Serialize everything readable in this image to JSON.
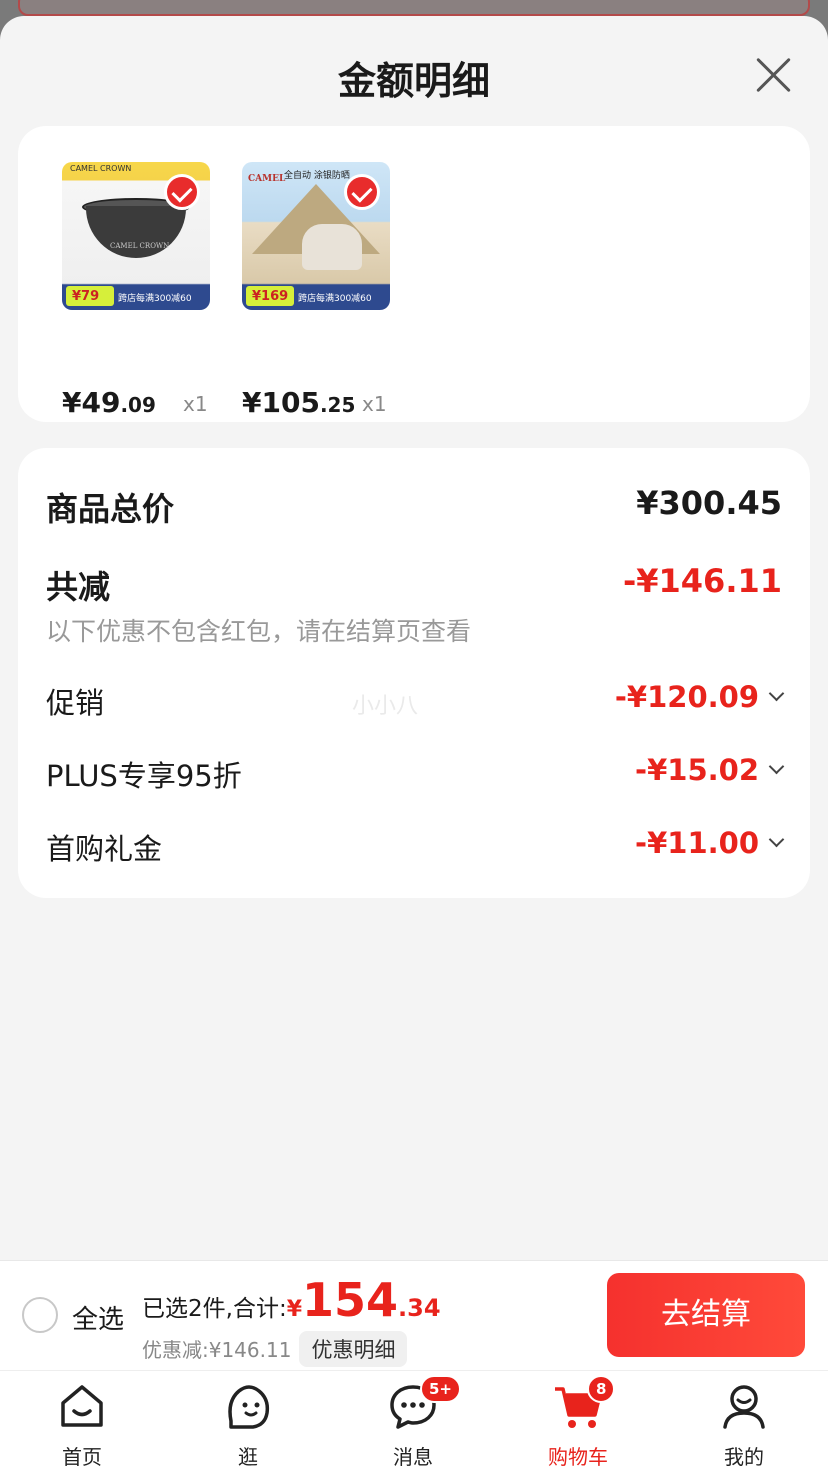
{
  "sheet": {
    "title": "金额明细"
  },
  "products": [
    {
      "price_yuan": "¥",
      "price_int": "49",
      "price_dec": ".09",
      "qty": "x1",
      "tag_price": "¥79",
      "strip": "跨店每满300减60",
      "checked": true
    },
    {
      "price_yuan": "¥",
      "price_int": "105",
      "price_dec": ".25",
      "qty": "x1",
      "tag_price": "¥169",
      "strip": "跨店每满300减60",
      "brand": "CAMEL",
      "headline": "全自动 涂银防晒",
      "checked": true
    }
  ],
  "details": {
    "total_label": "商品总价",
    "total_value": "¥300.45",
    "reduce_label": "共减",
    "reduce_value": "-¥146.11",
    "reduce_note": "以下优惠不包含红包，请在结算页查看",
    "items": [
      {
        "label": "促销",
        "value": "-¥120.09"
      },
      {
        "label": "PLUS专享95折",
        "value": "-¥15.02"
      },
      {
        "label": "首购礼金",
        "value": "-¥11.00"
      }
    ]
  },
  "watermark": "小小八",
  "checkout": {
    "select_all": "全选",
    "selected_summary": "已选2件,合计:",
    "total_symbol": "¥",
    "total_int": "154",
    "total_dec": ".34",
    "discount_text": "优惠减:¥146.11",
    "discount_detail_btn": "优惠明细",
    "checkout_btn": "去结算"
  },
  "tabbar": [
    {
      "label": "首页",
      "icon": "home-icon"
    },
    {
      "label": "逛",
      "icon": "face-icon"
    },
    {
      "label": "消息",
      "icon": "message-icon",
      "badge": "5+"
    },
    {
      "label": "购物车",
      "icon": "cart-icon",
      "badge": "8",
      "active": true
    },
    {
      "label": "我的",
      "icon": "user-icon"
    }
  ],
  "colors": {
    "accent_red": "#e8231c",
    "background": "#f4f4f4"
  }
}
